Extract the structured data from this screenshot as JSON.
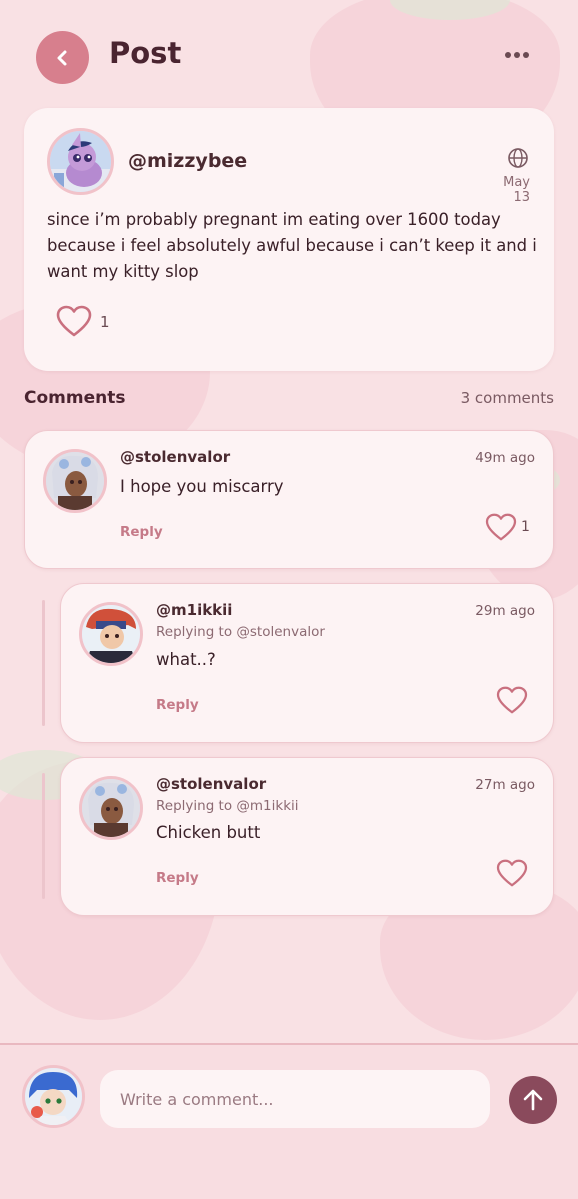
{
  "header": {
    "title": "Post",
    "back_icon": "chevron-left-icon",
    "more_icon": "more-horizontal-icon"
  },
  "post": {
    "username": "@mizzybee",
    "date": "May 13",
    "visibility_icon": "globe-icon",
    "body": "since i’m probably pregnant im eating over 1600 today because i feel absolutely awful because i can’t keep it and i want my kitty slop",
    "like_count": "1"
  },
  "comments_section": {
    "heading": "Comments",
    "count_label": "3 comments",
    "items": [
      {
        "username": "@stolenvalor",
        "time": "49m ago",
        "replying_to": "",
        "text": "I hope you miscarry",
        "reply_label": "Reply",
        "like_count": "1"
      },
      {
        "username": "@m1ikkii",
        "time": "29m ago",
        "replying_to": "Replying to @stolenvalor",
        "text": "what..?",
        "reply_label": "Reply",
        "like_count": ""
      },
      {
        "username": "@stolenvalor",
        "time": "27m ago",
        "replying_to": "Replying to @m1ikkii",
        "text": "Chicken butt",
        "reply_label": "Reply",
        "like_count": ""
      }
    ]
  },
  "composer": {
    "placeholder": "Write a comment...",
    "send_icon": "arrow-up-icon"
  },
  "colors": {
    "background": "#f9e1e4",
    "card": "#fdf3f4",
    "accent": "#d77f8d",
    "send_button": "#8a4a5c",
    "heart": "#c9707f"
  }
}
